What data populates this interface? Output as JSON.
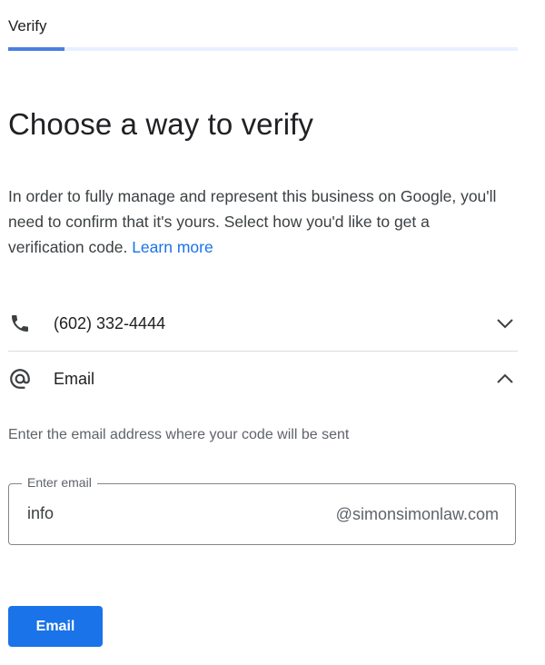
{
  "header": {
    "title": "Verify",
    "progress_fraction": 0.11
  },
  "main": {
    "title": "Choose a way to verify",
    "intro_text": "In order to fully manage and represent this business on Google, you'll need to confirm that it's yours. Select how you'd like to get a verification code.",
    "learn_more_label": "Learn more"
  },
  "options": {
    "phone": {
      "label": "(602) 332-4444",
      "icon": "phone-icon",
      "expanded": false
    },
    "email": {
      "label": "Email",
      "icon": "at-sign-icon",
      "expanded": true
    }
  },
  "email_panel": {
    "helper_text": "Enter the email address where your code will be sent",
    "field_label": "Enter email",
    "field_value": "info",
    "domain_suffix": "@simonsimonlaw.com",
    "submit_label": "Email"
  },
  "colors": {
    "accent": "#1a73e8",
    "progress_track": "#e8f0fe",
    "progress_fill": "#4a7fe0"
  }
}
